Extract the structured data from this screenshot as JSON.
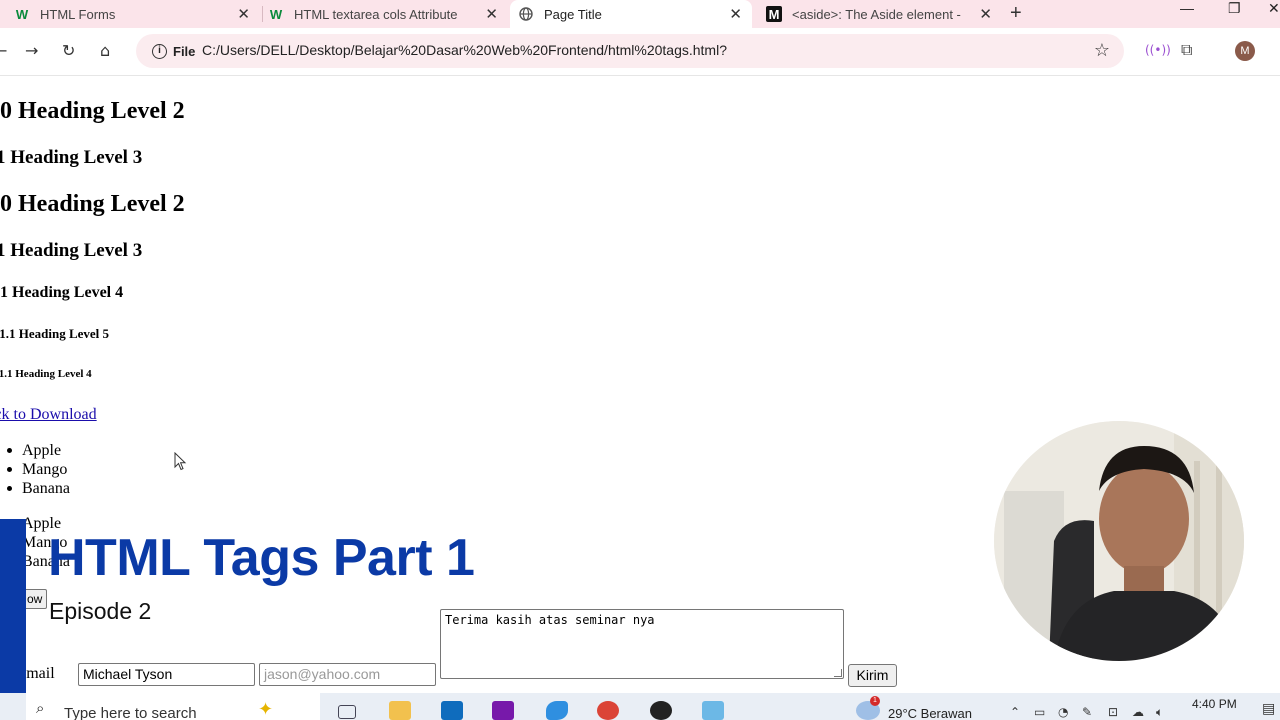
{
  "browser": {
    "tabs": [
      {
        "label": "HTML Forms",
        "favicon": "w-icon"
      },
      {
        "label": "HTML textarea cols Attribute",
        "favicon": "w-icon"
      },
      {
        "label": "Page Title",
        "favicon": "globe-icon"
      },
      {
        "label": "<aside>: The Aside element - H",
        "favicon": "mdn-icon"
      }
    ],
    "site_chip": "File",
    "url": "C:/Users/DELL/Desktop/Belajar%20Dasar%20Web%20Frontend/html%20tags.html?",
    "avatar_letter": "M"
  },
  "page": {
    "headings": [
      {
        "text": "0 Heading Level 2"
      },
      {
        "text": "1 Heading Level 3"
      },
      {
        "text": "0 Heading Level 2"
      },
      {
        "text": "1 Heading Level 3"
      },
      {
        "text": ".1 Heading Level 4"
      },
      {
        "text": ".1.1 Heading Level 5"
      },
      {
        "text": ".1.1 Heading Level 4"
      }
    ],
    "download_link": "ick to Download",
    "unordered_list": [
      "Apple",
      "Mango",
      "Banana"
    ],
    "ordered_list": [
      "Apple",
      "Mango",
      "Banana"
    ],
    "button_label": "ow",
    "form": {
      "label": "t Email",
      "name_value": "Michael Tyson",
      "email_placeholder": "jason@yahoo.com",
      "textarea_value": "Terima kasih atas seminar nya",
      "submit_label": "Kirim"
    }
  },
  "overlay": {
    "title": "HTML Tags Part 1",
    "subtitle": "Episode 2",
    "accent_color": "#0b3aa6"
  },
  "taskbar": {
    "search_placeholder": "Type here to search",
    "weather": "29°C  Berawan",
    "time": "4:40 PM",
    "notification_count": "1"
  }
}
